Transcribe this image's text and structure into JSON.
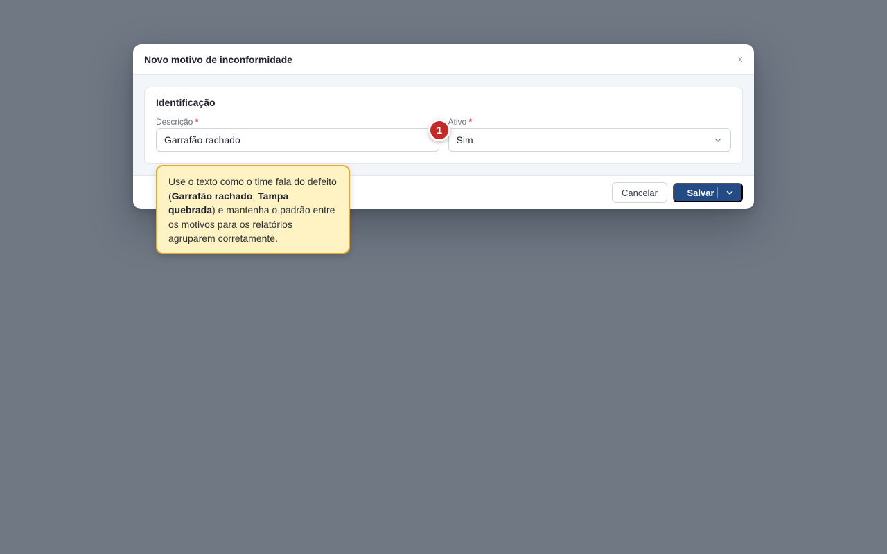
{
  "modal": {
    "title": "Novo motivo de inconformidade",
    "close_label": "x"
  },
  "section": {
    "title": "Identificação"
  },
  "fields": {
    "descricao": {
      "label": "Descrição",
      "required_mark": "*",
      "value": "Garrafão rachado"
    },
    "ativo": {
      "label": "Ativo",
      "required_mark": "*",
      "value": "Sim"
    }
  },
  "footer": {
    "cancel_label": "Cancelar",
    "save_label": "Salvar"
  },
  "tip": {
    "step_number": "1",
    "text_1": "Use o texto como o time fala do defeito (",
    "bold_1": "Garrafão rachado",
    "sep": ", ",
    "bold_2": "Tampa quebrada",
    "text_2": ") e mantenha o padrão entre os motivos para os relatórios agruparem corretamente."
  },
  "colors": {
    "backdrop": "#707884",
    "primary": "#234b85",
    "badge": "#c62828",
    "tooltip_bg": "#fff3c4",
    "tooltip_border": "#e6a92a"
  },
  "icons": {
    "close": "close-icon",
    "select_chevron": "chevron-down-icon",
    "save_caret": "chevron-down-icon"
  }
}
